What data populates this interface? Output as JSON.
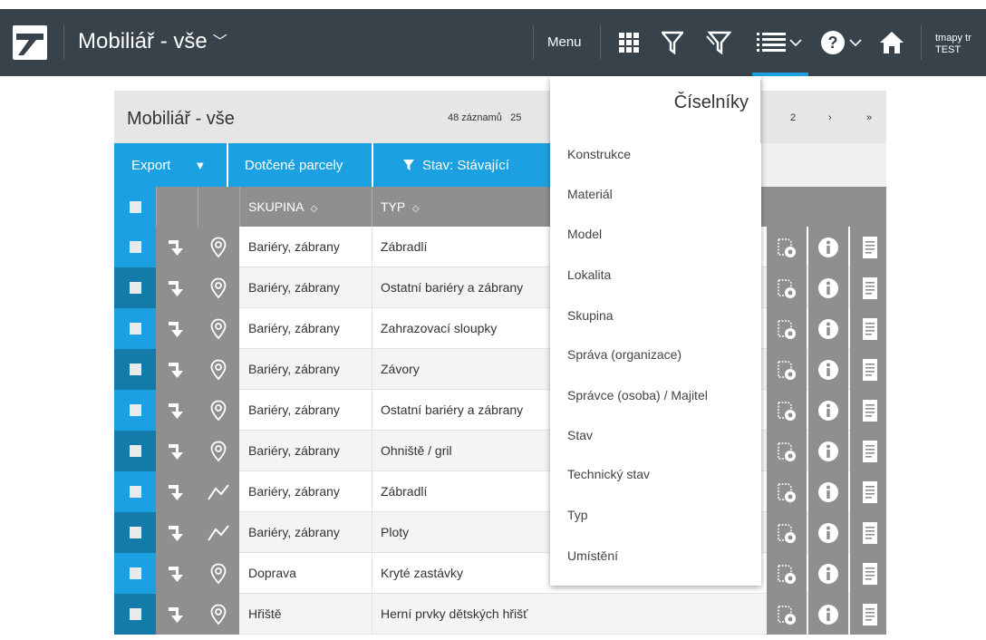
{
  "app": {
    "title": "Mobiliář - vše",
    "title_chevron": "﹀",
    "menu_label": "Menu",
    "user_name": "tmapy tr",
    "user_sub": "TEST"
  },
  "toolbar_icons": [
    "grid-icon",
    "filter-icon",
    "filter-multi-icon",
    "list-icon",
    "help-icon",
    "home-icon"
  ],
  "panel": {
    "title": "Mobiliář - vše",
    "count": "48 záznamů",
    "count_suffix": "25",
    "pager": [
      "2",
      "›",
      "»"
    ],
    "export_label": "Export",
    "export_arrow": "▼",
    "parcels_label": "Dotčené parcely",
    "filter_label": "Stav: Stávající",
    "columns": {
      "group": "SKUPINA",
      "type": "TYP",
      "sort_glyph": "◇"
    },
    "rows": [
      {
        "geom": "point",
        "group": "Bariéry, zábrany",
        "type": "Zábradlí"
      },
      {
        "geom": "point",
        "group": "Bariéry, zábrany",
        "type": "Ostatní bariéry a zábrany"
      },
      {
        "geom": "point",
        "group": "Bariéry, zábrany",
        "type": "Zahrazovací sloupky"
      },
      {
        "geom": "point",
        "group": "Bariéry, zábrany",
        "type": "Závory"
      },
      {
        "geom": "point",
        "group": "Bariéry, zábrany",
        "type": "Ostatní bariéry a zábrany"
      },
      {
        "geom": "point",
        "group": "Bariéry, zábrany",
        "type": "Ohniště / gril"
      },
      {
        "geom": "line",
        "group": "Bariéry, zábrany",
        "type": "Zábradlí"
      },
      {
        "geom": "line",
        "group": "Bariéry, zábrany",
        "type": "Ploty"
      },
      {
        "geom": "point",
        "group": "Doprava",
        "type": "Kryté zastávky"
      },
      {
        "geom": "point",
        "group": "Hřiště",
        "type": "Herní prvky dětských hřišť"
      }
    ]
  },
  "dropdown": {
    "title": "Číselníky",
    "items": [
      "Konstrukce",
      "Materiál",
      "Model",
      "Lokalita",
      "Skupina",
      "Správa (organizace)",
      "Správce (osoba) / Majitel",
      "Stav",
      "Technický stav",
      "Typ",
      "Umístění"
    ]
  },
  "colors": {
    "topbar": "#37424a",
    "accent": "#1ba1e2",
    "accent_dark": "#147aa9",
    "table_gray": "#8f8f8f",
    "header_gray": "#e6e6e6"
  }
}
